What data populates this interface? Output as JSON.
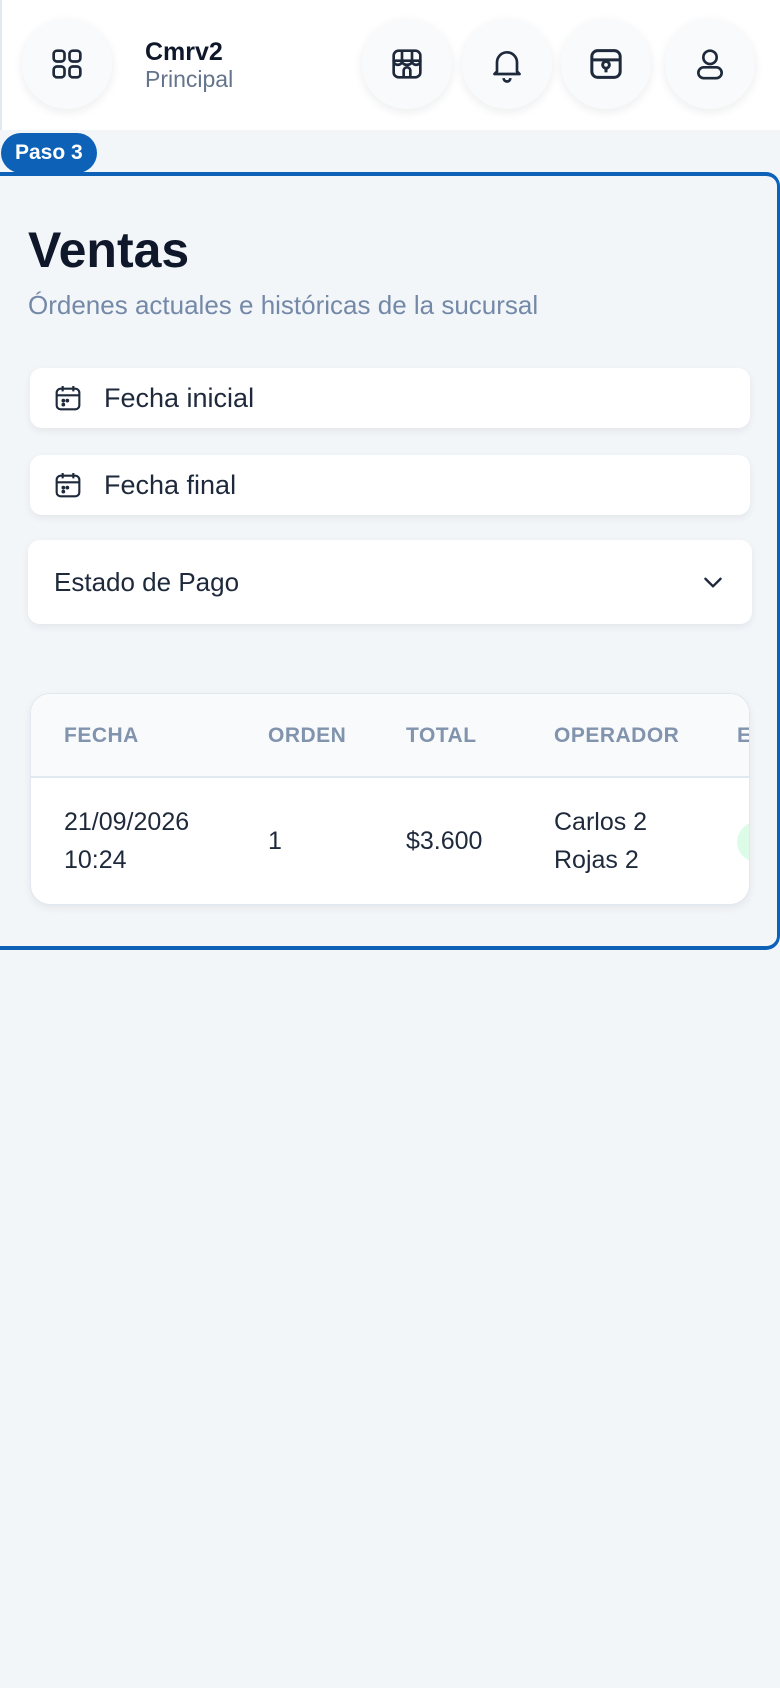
{
  "header": {
    "brand_name": "Cmrv2",
    "brand_sub": "Principal",
    "icons": [
      "grid-icon",
      "store-icon",
      "bell-icon",
      "safe-icon",
      "user-icon"
    ]
  },
  "step_badge": "Paso 3",
  "page": {
    "title": "Ventas",
    "subtitle": "Órdenes actuales e históricas de la sucursal"
  },
  "filters": {
    "start_date_label": "Fecha inicial",
    "end_date_label": "Fecha final",
    "payment_status_label": "Estado de Pago"
  },
  "table": {
    "columns": [
      "FECHA",
      "ORDEN",
      "TOTAL",
      "OPERADOR",
      "ES"
    ],
    "rows": [
      {
        "fecha_line1": "21/09/2026",
        "fecha_line2": "10:24",
        "orden": "1",
        "total": "$3.600",
        "operador_line1": "Carlos 2",
        "operador_line2": "Rojas 2"
      }
    ]
  },
  "colors": {
    "accent": "#0d62b8",
    "subtitle": "#7489a8",
    "status_paid": "#dcfce7"
  }
}
